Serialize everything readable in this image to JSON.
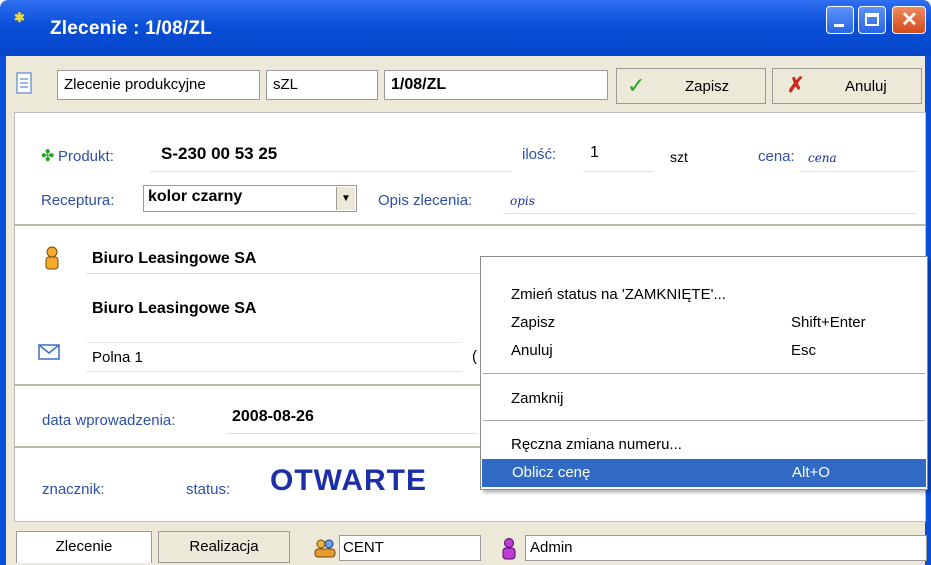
{
  "window": {
    "title": "Zlecenie : 1/08/ZL"
  },
  "toolbar": {
    "doc_type": "Zlecenie produkcyjne",
    "symbol": "sZL",
    "number": "1/08/ZL",
    "save_label": "Zapisz",
    "cancel_label": "Anuluj"
  },
  "product": {
    "label": "Produkt:",
    "value": "S-230 00 53 25",
    "qty_label": "ilość:",
    "qty_value": "1",
    "unit": "szt",
    "price_label": "cena:",
    "price_value": "cena"
  },
  "recipe": {
    "label": "Receptura:",
    "value": "kolor czarny",
    "desc_label": "Opis zlecenia:",
    "desc_value": "opis"
  },
  "client": {
    "name1": "Biuro Leasingowe SA",
    "name2": "Biuro Leasingowe SA",
    "address": "Polna 1",
    "address_suffix": "("
  },
  "dates": {
    "entry_label": "data wprowadzenia:",
    "entry_value": "2008-08-26"
  },
  "status": {
    "marker_label": "znacznik:",
    "status_label": "status:",
    "status_value": "OTWARTE"
  },
  "context_menu": {
    "items": [
      {
        "label": "Zmień status na 'ZAMKNIĘTE'...",
        "shortcut": ""
      },
      {
        "label": "Zapisz",
        "shortcut": "Shift+Enter"
      },
      {
        "label": "Anuluj",
        "shortcut": "Esc"
      },
      {
        "label": "Zamknij",
        "shortcut": ""
      },
      {
        "label": "Ręczna zmiana numeru...",
        "shortcut": ""
      },
      {
        "label": "Oblicz cenę",
        "shortcut": "Alt+O"
      }
    ],
    "highlighted_index": 5,
    "highlight_color": "#316ac5"
  },
  "tabs": [
    {
      "label": "Zlecenie"
    },
    {
      "label": "Realizacja"
    }
  ],
  "footer": {
    "branch": "CENT",
    "user": "Admin"
  },
  "colors": {
    "title_bar": "#0a4fd8",
    "status_text": "#1c2fa8",
    "label_blue": "#2c4fa8"
  }
}
